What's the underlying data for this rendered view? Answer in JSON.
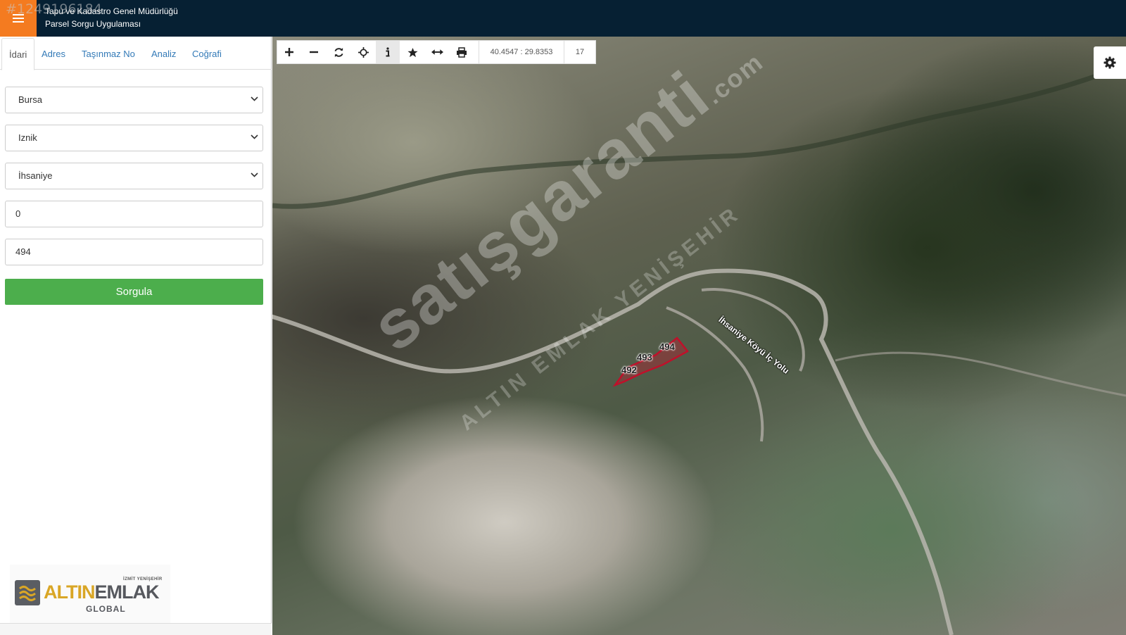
{
  "listing_id": "#1249196184",
  "header": {
    "title_line1": "Tapu ve Kadastro Genel Müdürlüğü",
    "title_line2": "Parsel Sorgu Uygulaması"
  },
  "sidebar": {
    "tabs": [
      {
        "label": "İdari",
        "active": true
      },
      {
        "label": "Adres",
        "active": false
      },
      {
        "label": "Taşınmaz No",
        "active": false
      },
      {
        "label": "Analiz",
        "active": false
      },
      {
        "label": "Coğrafi",
        "active": false
      }
    ],
    "fields": {
      "province": "Bursa",
      "district": "Iznik",
      "neighborhood": "İhsaniye",
      "block": "0",
      "parcel": "494"
    },
    "query_button": "Sorgula",
    "logo": {
      "top": "İZMİT YENİŞEHİR",
      "main_a": "ALTIN",
      "main_b": "EMLAK",
      "sub": "GLOBAL"
    }
  },
  "map": {
    "toolbar": {
      "icons": [
        "zoom-in-icon",
        "zoom-out-icon",
        "refresh-icon",
        "locate-icon",
        "info-icon",
        "star-icon",
        "measure-icon",
        "print-icon"
      ],
      "coords": "40.4547 : 29.8353",
      "zoom": "17"
    },
    "parcels": [
      "492",
      "493",
      "494"
    ],
    "road_label": "İhsaniye Köyü İç Yolu",
    "watermark": "satışgaranti",
    "watermark_tld": ".com",
    "watermark_sub": "ALTIN EMLAK YENİŞEHİR"
  },
  "colors": {
    "header_bg": "#062033",
    "menu_accent": "#f47b20",
    "query_button": "#4cae4c",
    "parcel_outline": "#c0102a",
    "link": "#337ab7"
  }
}
